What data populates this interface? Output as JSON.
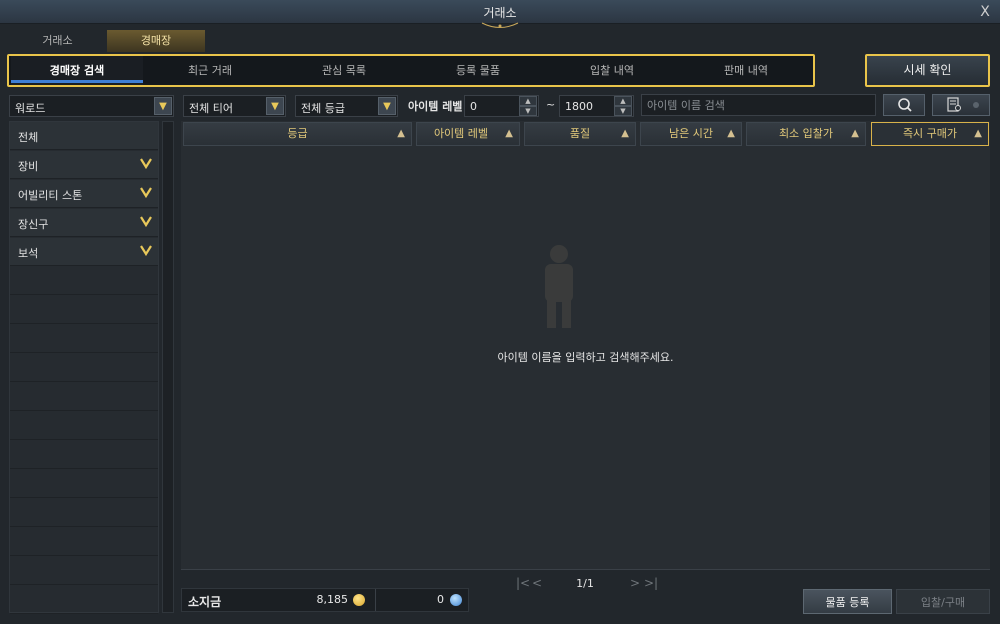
{
  "window": {
    "title": "거래소",
    "close_label": "X"
  },
  "top_tabs": [
    {
      "label": "거래소",
      "active": false
    },
    {
      "label": "경매장",
      "active": true
    }
  ],
  "sub_tabs": [
    {
      "label": "경매장 검색",
      "active": true
    },
    {
      "label": "최근 거래",
      "active": false
    },
    {
      "label": "관심 목록",
      "active": false
    },
    {
      "label": "등록 물품",
      "active": false
    },
    {
      "label": "입찰 내역",
      "active": false
    },
    {
      "label": "판매 내역",
      "active": false
    }
  ],
  "price_check_label": "시세 확인",
  "sidebar": {
    "region_value": "워로드",
    "categories": [
      {
        "label": "전체",
        "expandable": false
      },
      {
        "label": "장비",
        "expandable": true
      },
      {
        "label": "어빌리티 스톤",
        "expandable": true
      },
      {
        "label": "장신구",
        "expandable": true
      },
      {
        "label": "보석",
        "expandable": true
      }
    ]
  },
  "filters": {
    "tier_value": "전체 티어",
    "grade_value": "전체 등급",
    "item_level_label": "아이템 레벨",
    "level_min": "0",
    "level_max": "1800",
    "tilde": "~",
    "search_placeholder": "아이템 이름 검색"
  },
  "table": {
    "columns": [
      {
        "label": "등급",
        "selected": false
      },
      {
        "label": "아이템 레벨",
        "selected": false
      },
      {
        "label": "품질",
        "selected": false
      },
      {
        "label": "남은 시간",
        "selected": false
      },
      {
        "label": "최소 입찰가",
        "selected": false
      },
      {
        "label": "즉시 구매가",
        "selected": true
      }
    ],
    "sort_glyph": "▲",
    "empty_message": "아이템 이름을 입력하고 검색해주세요."
  },
  "pagination": {
    "page": "1/1"
  },
  "footer": {
    "money_label": "소지금",
    "gold": "8,185",
    "crystal": "0",
    "register_label": "물품 등록",
    "bid_label": "입찰/구매"
  },
  "colors": {
    "highlight_border": "#e9c44a",
    "active_tab_underline": "#3e7fd6",
    "gold_coin": "#e6b93b",
    "crystal": "#5aa0e6"
  },
  "icons": [
    "close-icon",
    "chevron-down-icon",
    "sort-asc-icon",
    "search-icon",
    "filter-list-icon",
    "gold-coin-icon",
    "crystal-icon",
    "first-page-icon",
    "prev-page-icon",
    "next-page-icon",
    "last-page-icon"
  ]
}
